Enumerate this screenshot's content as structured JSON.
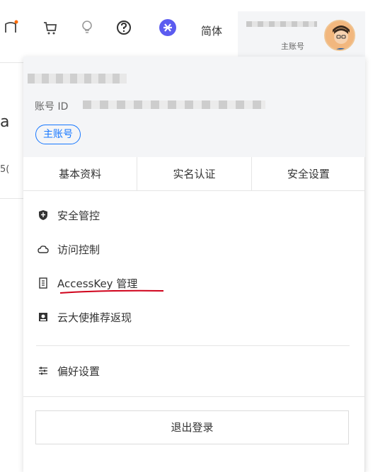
{
  "topbar": {
    "icons": [
      "notification-icon",
      "cart-icon",
      "lightbulb-icon",
      "help-icon",
      "feature-icon"
    ],
    "language_label": "简体",
    "account_type_label": "主账号",
    "accent_color": "#1677ff",
    "notification_dot_color": "#ff6a00"
  },
  "page_bg": {
    "fragment_1": "a",
    "fragment_2": "5("
  },
  "dropdown": {
    "account_id_label": "账号 ID",
    "badge_label": "主账号",
    "tabs": [
      {
        "label": "基本资料"
      },
      {
        "label": "实名认证"
      },
      {
        "label": "安全设置"
      }
    ],
    "menu": [
      {
        "label": "安全管控",
        "icon": "shield-icon"
      },
      {
        "label": "访问控制",
        "icon": "cloud-icon"
      },
      {
        "label": "AccessKey 管理",
        "icon": "key-icon"
      },
      {
        "label": "云大使推荐返现",
        "icon": "ambassador-icon"
      }
    ],
    "preferences_label": "偏好设置",
    "logout_label": "退出登录"
  }
}
